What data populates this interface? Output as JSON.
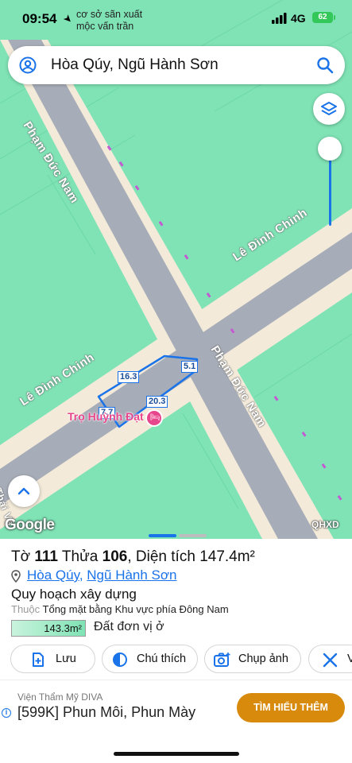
{
  "status_bar": {
    "time": "09:54",
    "map_label": "cơ sở sãn xuất\nmộc vấn trần",
    "network": "4G",
    "battery": "62"
  },
  "search": {
    "query": "Hòa Qúy, Ngũ Hành Sơn"
  },
  "map": {
    "streets": {
      "pham_duc_nam_top": "Phạm Đức Nam",
      "pham_duc_nam_bottom": "Phạm Đức Nam",
      "le_dinh_chinh_right": "Lê Đình Chinh",
      "le_dinh_chinh_left": "Lê Đình Chinh",
      "partial_bottom_left": "Thái Vă"
    },
    "parcel_dimensions": [
      "16.3",
      "5.1",
      "20.3",
      "7.7"
    ],
    "poi": "Trọ Huỳnh Đạt",
    "attribution": "Google",
    "layer_code": "QHXD",
    "colors": {
      "land": "#7fe3b5",
      "road": "#a7adb8",
      "sidewalk": "#f3ead9",
      "boundary": "#1a73e8",
      "poi": "#e8468c"
    }
  },
  "parcel": {
    "to_label": "Tờ",
    "to_value": "111",
    "thua_label": "Thửa",
    "thua_value": "106",
    "area_label": "Diện tích",
    "area_value": "147.4m²",
    "ward": "Hòa Qúy",
    "district": "Ngũ Hành Sơn",
    "plan_title": "Quy hoạch xây dựng",
    "plan_belongs_label": "Thuộc",
    "plan_belongs_value": "Tổng mặt bằng Khu vực phía Đông Nam",
    "zone_area": "143.3m²",
    "zone_type": "Đất đơn vị ở"
  },
  "actions": [
    {
      "label": "Lưu",
      "icon": "save-plus-icon"
    },
    {
      "label": "Chú thích",
      "icon": "legend-half-circle-icon"
    },
    {
      "label": "Chụp ảnh",
      "icon": "camera-icon"
    },
    {
      "label": "V",
      "icon": "tools-icon"
    }
  ],
  "ad": {
    "sponsor": "Viện Thẩm Mỹ DIVA",
    "headline": "[599K] Phun Môi, Phun Mày",
    "cta": "TÌM HIỂU THÊM"
  }
}
